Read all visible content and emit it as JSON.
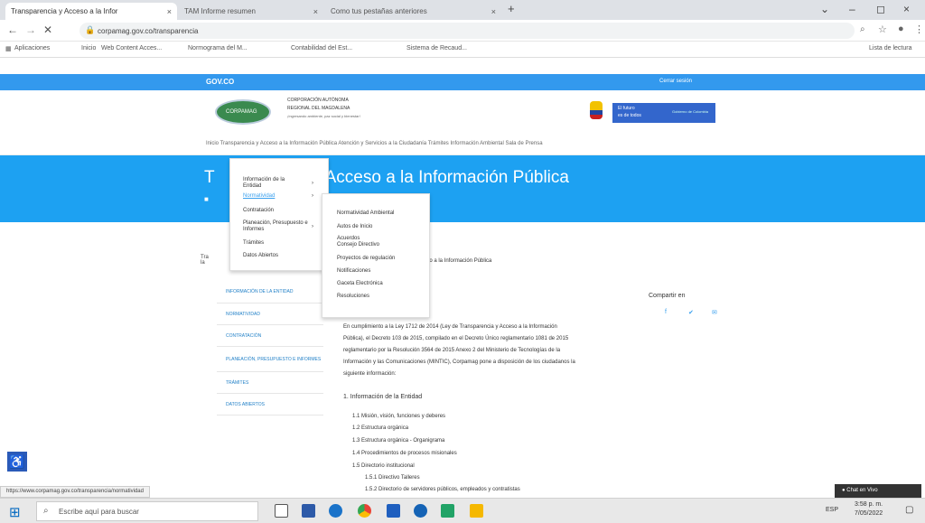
{
  "tabs": [
    {
      "label": "Transparencia y Acceso a la Infor",
      "active": true
    },
    {
      "label": "TAM Informe resumen",
      "active": false
    },
    {
      "label": "Como tus pestañas anteriores",
      "active": false
    }
  ],
  "new_tab": "+",
  "window_controls": [
    "⌄",
    "–",
    "◻",
    "×"
  ],
  "address": {
    "url": "corpamag.gov.co/transparencia"
  },
  "bookmarks": [
    "Aplicaciones",
    "Inicio",
    "Web Content Acces...",
    "Normograma del M...",
    "Contabilidad del Est...",
    "Sistema de Recaud...",
    "Lista de lectura"
  ],
  "gov_bar": {
    "left": "GOV.CO",
    "right": "Cerrar sesión"
  },
  "org": {
    "line1": "CORPORACIÓN AUTÓNOMA",
    "line2": "REGIONAL DEL MAGDALENA",
    "line3": "¡Ingresando ambiente, paz social y bienestar!",
    "logo_text": "CORPAMAG",
    "gov_text1": "El futuro",
    "gov_text2": "es de todos",
    "gov_text3": "Gobierno de Colombia"
  },
  "topnav": "Inicio Transparencia y Acceso a la Información Pública Atención y Servicios a la Ciudadanía Trámites Información Ambiental Sala de Prensa",
  "banner_title": "Acceso a la Información Pública",
  "banner_prefix": "T",
  "menu1": {
    "items": [
      "Información de la Entidad",
      "Normatividad",
      "Contratación",
      "Planeación, Presupuesto e Informes",
      "Trámites",
      "Datos Abiertos"
    ]
  },
  "menu2": {
    "items": [
      "Normatividad Ambiental",
      "Autos de Inicio",
      "Acuerdos Consejo Directivo",
      "Proyectos de regulación",
      "Notificaciones",
      "Gaceta Electrónica",
      "Resoluciones"
    ]
  },
  "sidebar": [
    "Información de la Entidad",
    "Normatividad",
    "Contratación",
    "Planeación, Presupuesto e Informes",
    "Trámites",
    "Datos Abiertos"
  ],
  "content": {
    "sub_title": "ceso a la Información Pública",
    "share": "Compartir en",
    "p1": "En cumplimiento a la Ley 1712 de 2014 (Ley de Transparencia y Acceso a la Información",
    "p2": "Pública), el Decreto 103 de 2015, compilado en el Decreto Único reglamentario 1081 de 2015",
    "p3": "reglamentario por la Resolución 3564 de 2015 Anexo 2 del Ministerio de Tecnologías de la",
    "p4": "Información y las Comunicaciones (MINTIC), Corpamag pone a disposición de los ciudadanos la",
    "p5": "siguiente información:",
    "section": "1. Información de la Entidad",
    "list": [
      "1.1 Misión, visión, funciones y deberes",
      "1.2 Estructura orgánica",
      "1.3 Estructura orgánica - Organigrama",
      "1.4 Procedimientos de procesos misionales",
      "1.5 Directorio institucional",
      "1.5.1 Directivo Talleres",
      "1.5.2 Directorio de servidores públicos, empleados y contratistas"
    ]
  },
  "status_url": "https://www.corpamag.gov.co/transparencia/normatividad",
  "chat_button": "Chat en Vivo",
  "taskbar": {
    "search_placeholder": "Escribe aquí para buscar",
    "time": "3:58 p. m.",
    "date": "7/05/2022",
    "lang": "ESP"
  }
}
